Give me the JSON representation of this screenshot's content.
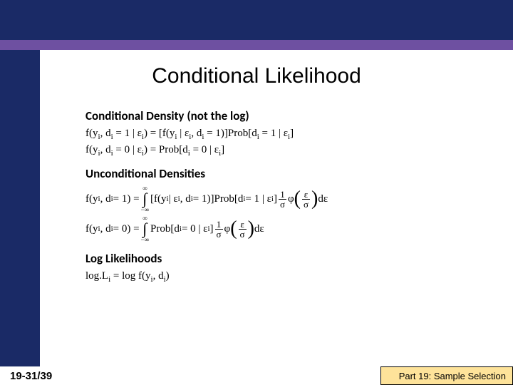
{
  "title": "Conditional Likelihood",
  "sections": {
    "s1": {
      "heading": "Conditional Density (not the log)",
      "eq1_lhs": "f(y",
      "eq1_sub1": "i",
      "eq1_mid1": ", d",
      "eq1_sub2": "i",
      "eq1_mid2": " = 1 | ε",
      "eq1_sub3": "i",
      "eq1_mid3": ") = [f(y",
      "eq1_sub4": "i",
      "eq1_mid4": " | ε",
      "eq1_sub5": "i",
      "eq1_mid5": ", d",
      "eq1_sub6": "i",
      "eq1_mid6": " = 1)]Prob[d",
      "eq1_sub7": "i",
      "eq1_mid7": " = 1 | ε",
      "eq1_sub8": "i",
      "eq1_end": "]",
      "eq2_lhs": "f(y",
      "eq2_sub1": "i",
      "eq2_mid1": ", d",
      "eq2_sub2": "i",
      "eq2_mid2": " = 0 | ε",
      "eq2_sub3": "i",
      "eq2_mid3": ") = Prob[d",
      "eq2_sub4": "i",
      "eq2_mid4": " = 0 | ε",
      "eq2_sub5": "i",
      "eq2_end": "]"
    },
    "s2": {
      "heading": "Unconditional Densities",
      "int_upper": "∞",
      "int_lower": "−∞",
      "frac_num": "1",
      "frac_den": "σ",
      "phi": "φ",
      "paren_num": "ε",
      "paren_den": "σ",
      "depsilon": "dε",
      "eq1_a": "f(y",
      "eq1_b": ", d",
      "eq1_c": " = 1) = ",
      "eq1_d": " [f(y",
      "eq1_e": " | ε",
      "eq1_f": ", d",
      "eq1_g": " = 1)]Prob[d",
      "eq1_h": " = 1 | ε",
      "eq1_i": "] ",
      "eq2_a": "f(y",
      "eq2_b": ", d",
      "eq2_c": " = 0) = ",
      "eq2_d": " Prob[d",
      "eq2_e": " = 0 | ε",
      "eq2_f": "] ",
      "sub_i": "i"
    },
    "s3": {
      "heading": "Log Likelihoods",
      "eq_a": "log.L",
      "eq_b": " = log f(y",
      "eq_c": ", d",
      "eq_d": ")",
      "sub_i": "i"
    }
  },
  "footer": {
    "left": "19-31/39",
    "right": "Part 19: Sample Selection"
  }
}
